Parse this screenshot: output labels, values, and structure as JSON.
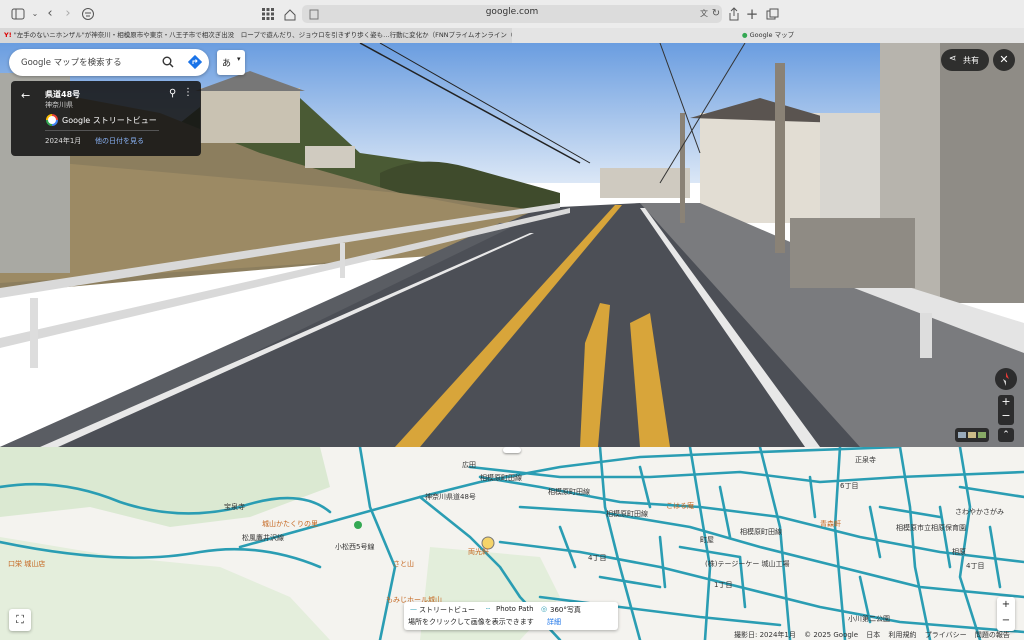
{
  "browser": {
    "url": "google.com",
    "tabs": [
      {
        "label": "\"左手のないニホンザル\"が神奈川・相模原市や東京・八王子市で相次ぎ出没　ロープで遊んだり、ジョウロを引きずり歩く姿も…行動に変化か（FNNプライムオンライン（フジテレビ系）） - Yahoo!ニ…"
      },
      {
        "label": "Google マップ"
      }
    ]
  },
  "streetview": {
    "search_placeholder": "Google マップを検索する",
    "input_method": "あ",
    "road_name": "県道48号",
    "prefecture": "神奈川県",
    "service_label": "Google ストリートビュー",
    "capture_date": "2024年1月",
    "other_dates_link": "他の日付を見る",
    "share_label": "共有",
    "road_marking": "県道48号"
  },
  "map": {
    "labels": [
      {
        "text": "広田",
        "cls": ""
      },
      {
        "text": "相模原町田線",
        "cls": ""
      },
      {
        "text": "相模原町田線",
        "cls": ""
      },
      {
        "text": "相模原町田線",
        "cls": ""
      },
      {
        "text": "相模原町田線",
        "cls": ""
      },
      {
        "text": "神奈川県道48号",
        "cls": ""
      },
      {
        "text": "宝泉寺",
        "cls": ""
      },
      {
        "text": "城山かたくりの里",
        "cls": "poi"
      },
      {
        "text": "松風鷹井沢線",
        "cls": ""
      },
      {
        "text": "小松西5号線",
        "cls": ""
      },
      {
        "text": "さと山",
        "cls": "poi"
      },
      {
        "text": "もみじホール城山",
        "cls": "poi"
      },
      {
        "text": "両光軒",
        "cls": "poi"
      },
      {
        "text": "こはる庵",
        "cls": "poi"
      },
      {
        "text": "(株)テージーケー 城山工場",
        "cls": ""
      },
      {
        "text": "青森軒",
        "cls": "poi"
      },
      {
        "text": "相模原市立相原保育園",
        "cls": ""
      },
      {
        "text": "さわやかさがみ",
        "cls": ""
      },
      {
        "text": "正泉寺",
        "cls": ""
      },
      {
        "text": "6丁目",
        "cls": ""
      },
      {
        "text": "4丁目",
        "cls": ""
      },
      {
        "text": "1丁目",
        "cls": ""
      },
      {
        "text": "町屋",
        "cls": ""
      },
      {
        "text": "相原",
        "cls": ""
      },
      {
        "text": "4丁目",
        "cls": ""
      },
      {
        "text": "口栄 城山店",
        "cls": "poi"
      },
      {
        "text": "小川第二公園",
        "cls": ""
      }
    ],
    "legend": {
      "item1": "ストリートビュー",
      "item2": "Photo Path",
      "item3": "360°写真",
      "hint": "場所をクリックして画像を表示できます",
      "detail_link": "詳細"
    },
    "footer": [
      "撮影日: 2024年1月",
      "© 2025 Google",
      "日本",
      "利用規約",
      "プライバシー",
      "問題の報告"
    ]
  }
}
